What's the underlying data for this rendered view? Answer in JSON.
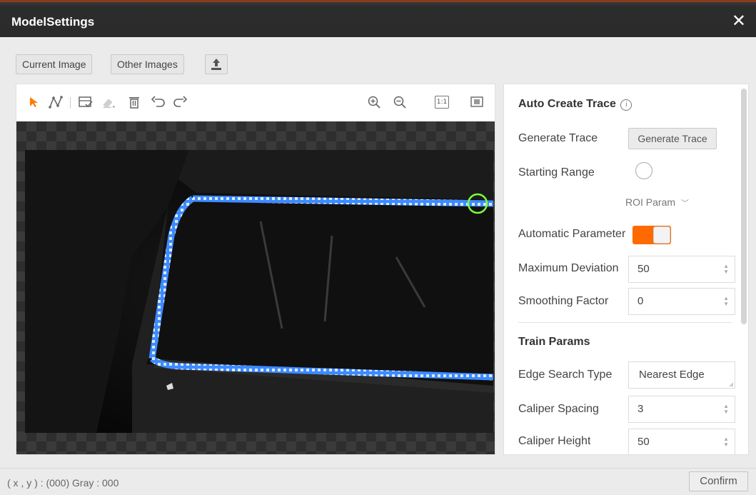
{
  "window": {
    "title": "ModelSettings",
    "close_icon": "close-icon"
  },
  "topbar": {
    "current_image": "Current Image",
    "other_images": "Other Images",
    "upload_icon": "upload-icon"
  },
  "toolbar": {
    "left_tools": [
      "select-arrow-icon",
      "polyline-icon",
      "mask-edit-icon",
      "eraser-icon",
      "delete-icon",
      "undo-icon",
      "redo-icon"
    ],
    "right_tools": [
      "zoom-in-icon",
      "zoom-out-icon",
      "actual-size-icon",
      "fit-window-icon"
    ],
    "actual_size_label": "1:1",
    "accent_color": "#ff7a00"
  },
  "auto_create": {
    "heading": "Auto Create Trace",
    "info_icon": "info-icon",
    "generate_label": "Generate Trace",
    "generate_button": "Generate Trace",
    "starting_range_label": "Starting Range",
    "roi_param_label": "ROI Param",
    "automatic_param_label": "Automatic Parameter",
    "automatic_param_on": true,
    "max_deviation_label": "Maximum Deviation",
    "max_deviation_value": "50",
    "smoothing_label": "Smoothing Factor",
    "smoothing_value": "0"
  },
  "train_params": {
    "heading": "Train Params",
    "edge_search_label": "Edge Search Type",
    "edge_search_value": "Nearest Edge",
    "caliper_spacing_label": "Caliper Spacing",
    "caliper_spacing_value": "3",
    "caliper_height_label": "Caliper Height",
    "caliper_height_value": "50"
  },
  "status": {
    "text": "( x , y ) :  (000)  Gray : 000"
  },
  "footer": {
    "confirm": "Confirm"
  },
  "colors": {
    "toggle_on": "#ff6a00",
    "trace": "#3d8bff",
    "start_marker": "#7cff3a"
  }
}
